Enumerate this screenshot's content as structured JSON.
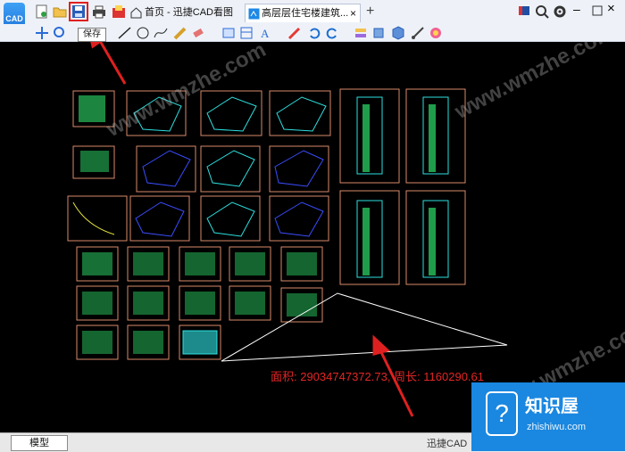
{
  "app": {
    "icon_label": "CAD"
  },
  "tooltip": {
    "text": "保存"
  },
  "tabs": [
    {
      "label": "首页 - 迅捷CAD看图"
    },
    {
      "label": "高层层住宅楼建筑..."
    }
  ],
  "canvas": {
    "measure_text": "面积: 29034747372.73, 周长: 1160290.61",
    "watermarks": [
      "www.wmzhe.com",
      "www.wmzhe.com",
      "www.wmzhe.com"
    ]
  },
  "bottom": {
    "model_tab": "模型",
    "app_name": "迅捷CAD"
  },
  "badge": {
    "title": "知识屋",
    "subtitle": "zhishiwu.com"
  },
  "colors": {
    "annotation_red": "#e02020",
    "canvas": "#000000",
    "sheet_border": "#d98a6a"
  }
}
